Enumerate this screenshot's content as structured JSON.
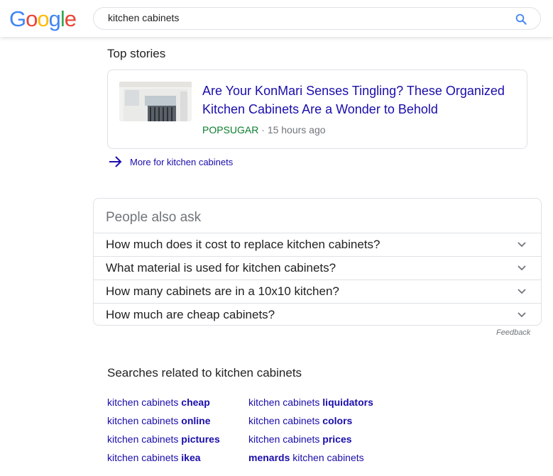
{
  "header": {
    "logo_letters": [
      {
        "ch": "G",
        "color": "#4285F4"
      },
      {
        "ch": "o",
        "color": "#EA4335"
      },
      {
        "ch": "o",
        "color": "#FBBC05"
      },
      {
        "ch": "g",
        "color": "#4285F4"
      },
      {
        "ch": "l",
        "color": "#34A853"
      },
      {
        "ch": "e",
        "color": "#EA4335"
      }
    ],
    "search_value": "kitchen cabinets",
    "search_icon": "search-icon"
  },
  "top_stories": {
    "heading": "Top stories",
    "story": {
      "title": "Are Your KonMari Senses Tingling? These Organized Kitchen Cabinets Are a Wonder to Behold",
      "source": "POPSUGAR",
      "separator": " · ",
      "time": "15 hours ago"
    },
    "more_label": "More for kitchen cabinets"
  },
  "people_also_ask": {
    "heading": "People also ask",
    "questions": [
      "How much does it cost to replace kitchen cabinets?",
      "What material is used for kitchen cabinets?",
      "How many cabinets are in a 10x10 kitchen?",
      "How much are cheap cabinets?"
    ],
    "feedback": "Feedback"
  },
  "related": {
    "heading": "Searches related to kitchen cabinets",
    "left": [
      {
        "pre": "kitchen cabinets ",
        "bold": "cheap",
        "post": ""
      },
      {
        "pre": "kitchen cabinets ",
        "bold": "online",
        "post": ""
      },
      {
        "pre": "kitchen cabinets ",
        "bold": "pictures",
        "post": ""
      },
      {
        "pre": "kitchen cabinets ",
        "bold": "ikea",
        "post": ""
      }
    ],
    "right": [
      {
        "pre": "kitchen cabinets ",
        "bold": "liquidators",
        "post": ""
      },
      {
        "pre": "kitchen cabinets ",
        "bold": "colors",
        "post": ""
      },
      {
        "pre": "kitchen cabinets ",
        "bold": "prices",
        "post": ""
      },
      {
        "pre": "",
        "bold": "menards",
        "post": " kitchen cabinets"
      }
    ]
  },
  "colors": {
    "link": "#1a0dab",
    "source_green": "#0b7d2e",
    "muted": "#70757a",
    "border": "#dfe1e5"
  }
}
